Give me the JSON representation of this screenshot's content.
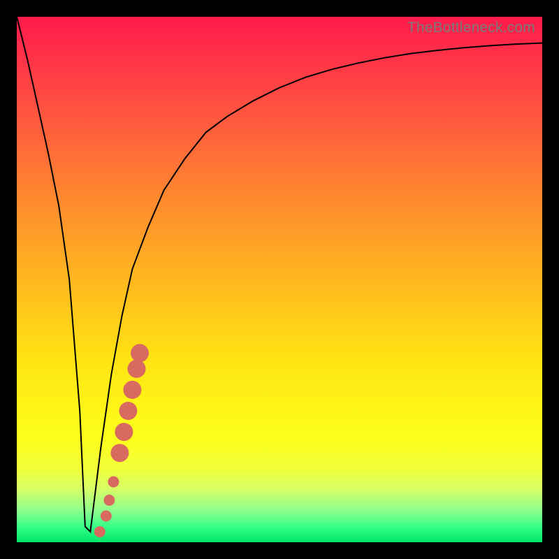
{
  "watermark": "TheBottleneck.com",
  "chart_data": {
    "type": "line",
    "title": "",
    "xlabel": "",
    "ylabel": "",
    "xlim": [
      0,
      100
    ],
    "ylim": [
      0,
      100
    ],
    "series": [
      {
        "name": "bottleneck-curve",
        "x": [
          0,
          2,
          4,
          6,
          8,
          10,
          12,
          13,
          14,
          16,
          18,
          20,
          22,
          25,
          28,
          32,
          36,
          40,
          45,
          50,
          55,
          60,
          65,
          70,
          75,
          80,
          85,
          90,
          95,
          100
        ],
        "y": [
          100,
          92,
          83,
          74,
          64,
          50,
          25,
          3,
          2,
          18,
          32,
          43,
          52,
          60,
          67,
          73,
          78,
          81,
          84,
          86.5,
          88.5,
          90,
          91.2,
          92.2,
          93,
          93.6,
          94.1,
          94.5,
          94.8,
          95
        ]
      }
    ],
    "markers": [
      {
        "name": "exclamation-dots",
        "points": [
          {
            "x": 15.8,
            "y": 2.0
          },
          {
            "x": 17.0,
            "y": 5.0
          },
          {
            "x": 17.6,
            "y": 8.0
          },
          {
            "x": 18.4,
            "y": 11.5
          },
          {
            "x": 19.6,
            "y": 17.0
          },
          {
            "x": 20.4,
            "y": 21.0
          },
          {
            "x": 21.2,
            "y": 25.0
          },
          {
            "x": 22.0,
            "y": 29.0
          },
          {
            "x": 22.8,
            "y": 33.0
          },
          {
            "x": 23.4,
            "y": 36.0
          }
        ],
        "color": "#d96a60"
      }
    ]
  }
}
